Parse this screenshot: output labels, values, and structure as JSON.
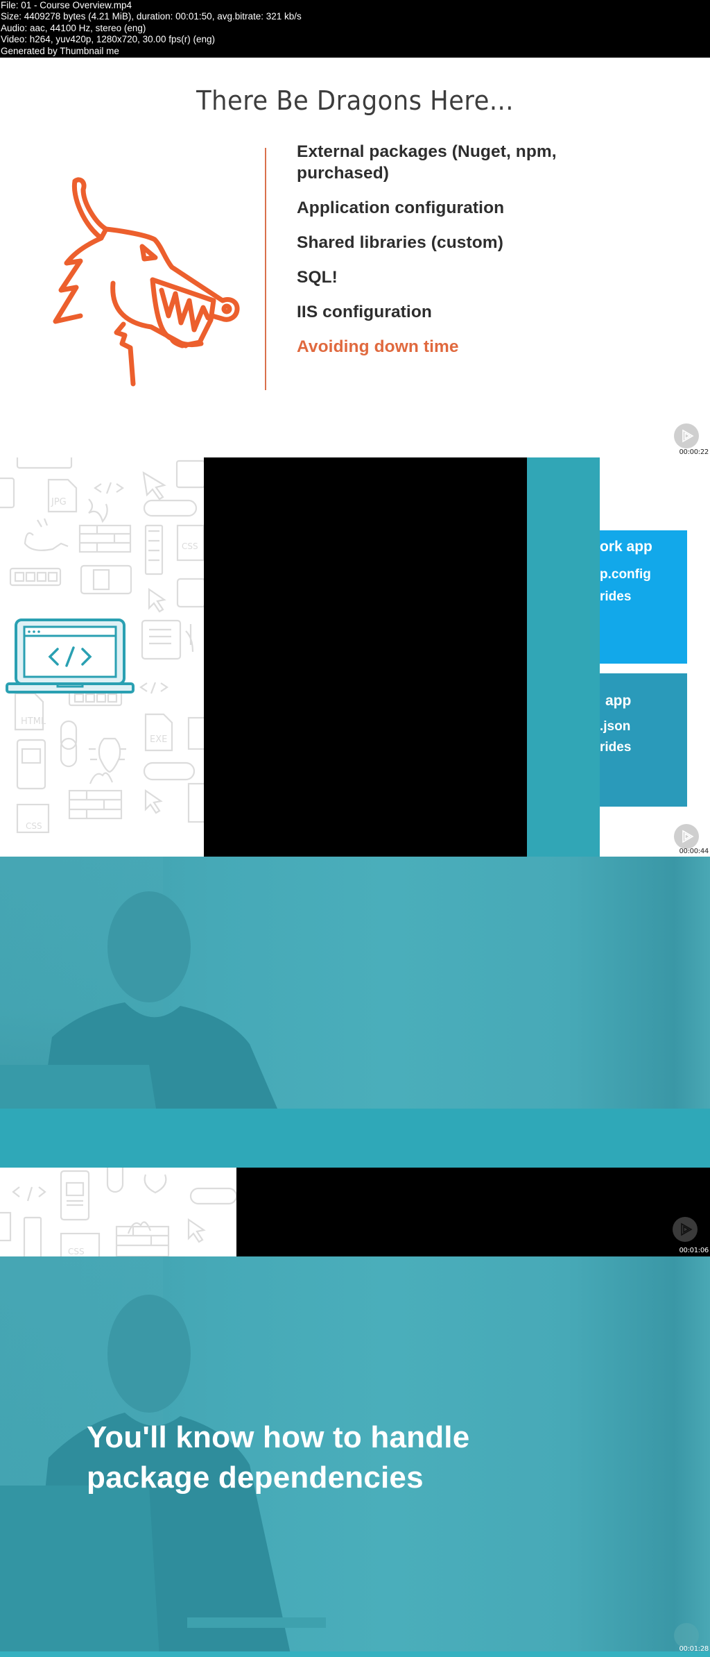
{
  "header": {
    "lines": [
      "File: 01 - Course Overview.mp4",
      "Size: 4409278 bytes (4.21 MiB), duration: 00:01:50, avg.bitrate: 321 kb/s",
      "Audio: aac, 44100 Hz, stereo (eng)",
      "Video: h264, yuv420p, 1280x720, 30.00 fps(r) (eng)",
      "Generated by Thumbnail me"
    ]
  },
  "frames": [
    {
      "timestamp": "00:00:22",
      "slide": {
        "title": "There Be Dragons Here...",
        "icon": "dragon-icon",
        "bullets": [
          {
            "text": "External packages (Nuget, npm, purchased)",
            "highlighted": false
          },
          {
            "text": "Application configuration",
            "highlighted": false
          },
          {
            "text": "Shared libraries (custom)",
            "highlighted": false
          },
          {
            "text": "SQL!",
            "highlighted": false
          },
          {
            "text": "IIS configuration",
            "highlighted": false
          },
          {
            "text": "Avoiding down time",
            "highlighted": true
          }
        ]
      }
    },
    {
      "timestamp": "00:00:44",
      "slide": {
        "icon": "laptop-code-icon",
        "boxes": [
          {
            "title": "ork app",
            "lines": [
              "p.config",
              "rides"
            ]
          },
          {
            "title": "app",
            "lines": [
              ".json",
              "rides"
            ]
          }
        ]
      }
    },
    {
      "timestamp": "00:01:06"
    },
    {
      "timestamp": "00:01:28",
      "slide": {
        "headline_line1": "You'll know how to handle",
        "headline_line2": "package dependencies"
      }
    }
  ],
  "colors": {
    "accent_orange": "#e0693e",
    "teal": "#31a6b6",
    "blue_box": "#12a8ea",
    "blue_box_dark": "#2a9aba"
  }
}
